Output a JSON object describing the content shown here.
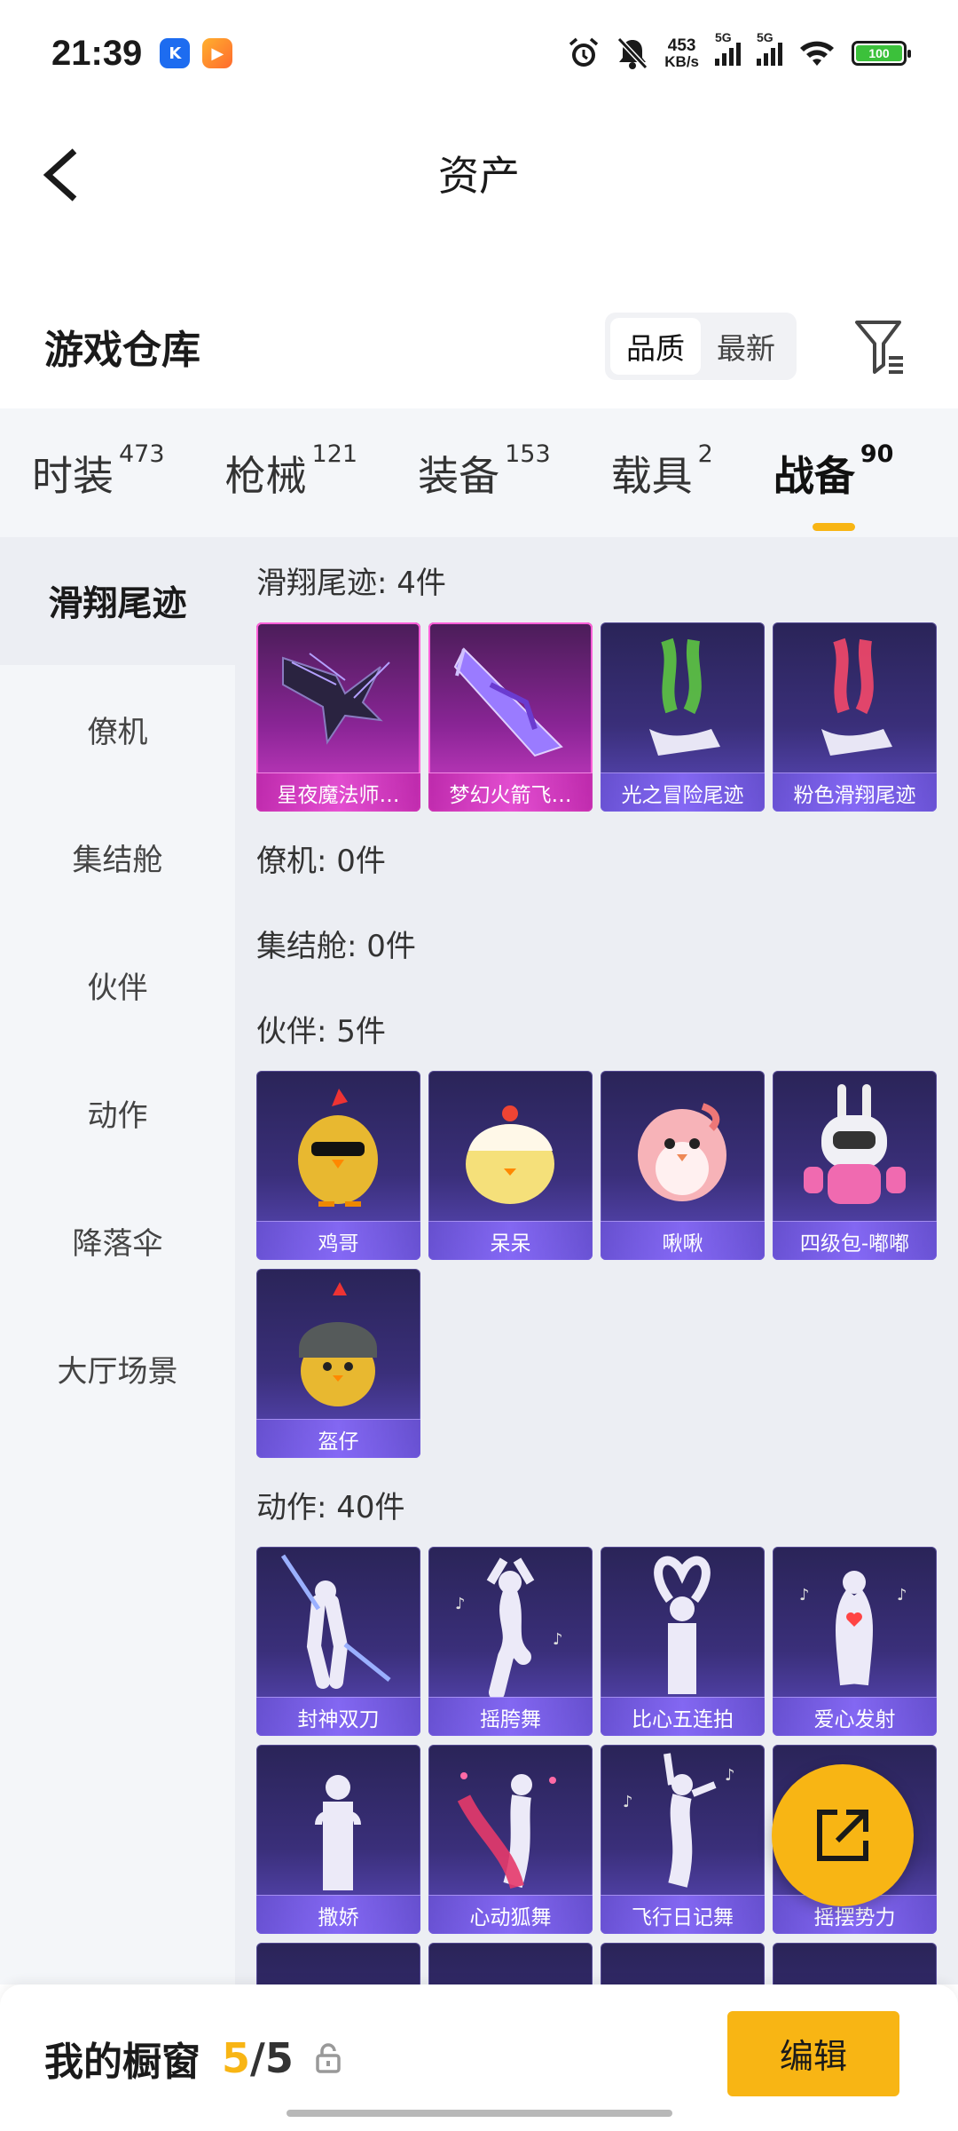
{
  "status_bar": {
    "time": "21:39",
    "app_icons": [
      "K",
      "▶"
    ],
    "net_speed_value": "453",
    "net_speed_unit": "KB/s",
    "signal_1_label": "5G",
    "signal_2_label": "5G",
    "battery": "100"
  },
  "header": {
    "title": "资产"
  },
  "warehouse": {
    "title": "游戏仓库",
    "sort_options": [
      "品质",
      "最新"
    ],
    "sort_selected": "品质"
  },
  "tabs": [
    {
      "label": "时装",
      "count": "473"
    },
    {
      "label": "枪械",
      "count": "121"
    },
    {
      "label": "装备",
      "count": "153"
    },
    {
      "label": "载具",
      "count": "2"
    },
    {
      "label": "战备",
      "count": "90",
      "active": true
    }
  ],
  "sidebar": {
    "items": [
      "滑翔尾迹",
      "僚机",
      "集结舱",
      "伙伴",
      "动作",
      "降落伞",
      "大厅场景"
    ],
    "active": "滑翔尾迹"
  },
  "sections": {
    "glide": {
      "title": "滑翔尾迹: 4件",
      "items": [
        "星夜魔法师…",
        "梦幻火箭飞…",
        "光之冒险尾迹",
        "粉色滑翔尾迹"
      ]
    },
    "wingman": {
      "title": "僚机: 0件"
    },
    "pod": {
      "title": "集结舱: 0件"
    },
    "partner": {
      "title": "伙伴: 5件",
      "items": [
        "鸡哥",
        "呆呆",
        "啾啾",
        "四级包-嘟嘟",
        "盔仔"
      ]
    },
    "emote": {
      "title": "动作: 40件",
      "items": [
        "封神双刀",
        "摇胯舞",
        "比心五连拍",
        "爱心发射",
        "撒娇",
        "心动狐舞",
        "飞行日记舞",
        "摇摆势力"
      ]
    }
  },
  "bottom_bar": {
    "label": "我的橱窗",
    "count_current": "5",
    "count_sep": "/",
    "count_max": "5",
    "edit_label": "编辑"
  },
  "colors": {
    "accent": "#f8b514",
    "card_purple": "#3a2f7a",
    "card_pink": "#d23fc9"
  }
}
